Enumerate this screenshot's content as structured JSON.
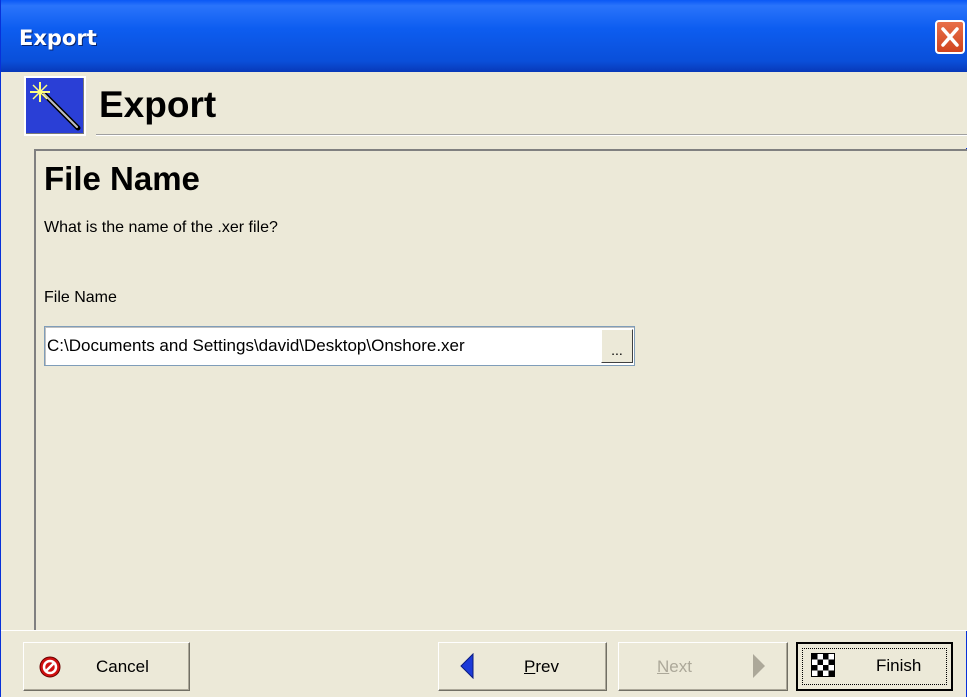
{
  "window": {
    "title": "Export",
    "close_icon": "close-icon"
  },
  "header": {
    "title": "Export",
    "icon": "magic-wand-icon"
  },
  "page": {
    "title": "File Name",
    "question": "What is the name of the .xer file?",
    "field_label": "File Name",
    "file_value": "C:\\Documents and Settings\\david\\Desktop\\Onshore.xer",
    "browse_label": "..."
  },
  "buttons": {
    "cancel": "Cancel",
    "prev_first": "P",
    "prev_rest": "rev",
    "next_first": "N",
    "next_rest": "ext",
    "finish": "Finish"
  },
  "colors": {
    "titlebar": "#0a58f5",
    "window_bg": "#ece9d8",
    "close": "#d0441e"
  }
}
